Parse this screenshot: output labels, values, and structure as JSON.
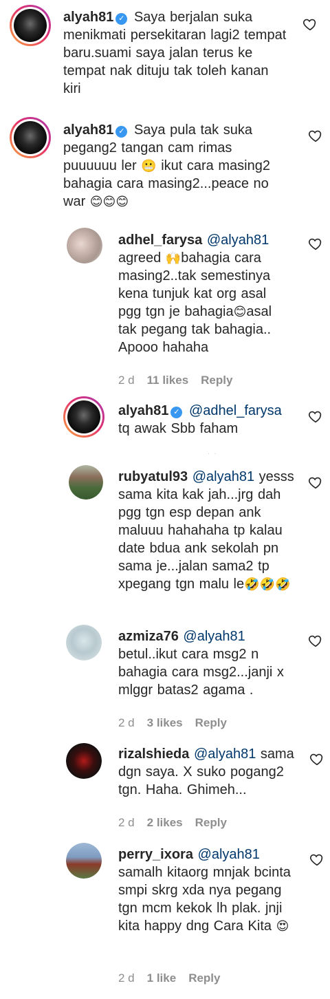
{
  "comments": [
    {
      "username": "alyah81",
      "mention": "",
      "text": "Saya berjalan suka menikmati persekitaran lagi2 tempat baru.suami saya jalan terus ke tempat nak dituju tak toleh kanan kiri",
      "verified": true
    },
    {
      "username": "alyah81",
      "mention": "",
      "text_a": "Saya pula tak suka pegang2 tangan cam rimas puuuuuu ler",
      "text_b": "ikut cara masing2 bahagia cara masing2...peace no war",
      "emoji_a": "😬",
      "emoji_b": "😊😊😊",
      "verified": true
    },
    {
      "username": "adhel_farysa",
      "mention": "@alyah81",
      "text_a": "agreed",
      "emoji_a": "🙌",
      "text_b": "bahagia cara masing2..tak semestinya kena tunjuk kat org asal pgg tgn je bahagia",
      "emoji_b": "😊",
      "text_c": "asal tak pegang tak bahagia.. Apooo hahaha",
      "time": "2 d",
      "likes": "11 likes",
      "reply": "Reply"
    },
    {
      "username": "alyah81",
      "mention": "@adhel_farysa",
      "text": "tq awak Sbb faham",
      "verified": true
    },
    {
      "username": "rubyatul93",
      "mention": "@alyah81",
      "text": "yesss sama kita kak jah...jrg dah pgg tgn esp depan ank maluuu hahahaha tp kalau date bdua ank sekolah pn sama je...jalan sama2 tp xpegang tgn malu le",
      "emoji": "🤣🤣🤣"
    },
    {
      "username": "azmiza76",
      "mention": "@alyah81",
      "text": "betul..ikut cara msg2 n bahagia cara msg2...janji x mlggr batas2 agama .",
      "time": "2 d",
      "likes": "3 likes",
      "reply": "Reply"
    },
    {
      "username": "rizalshieda",
      "mention": "@alyah81",
      "text": "sama dgn saya. X suko pogang2 tgn. Haha. Ghimeh...",
      "time": "2 d",
      "likes": "2 likes",
      "reply": "Reply"
    },
    {
      "username": "perry_ixora",
      "mention": "@alyah81",
      "text": "samalh kitaorg mnjak bcinta smpi skrg xda nya pegang tgn mcm kekok lh plak. jnji kita happy dng Cara Kita",
      "emoji": "😍",
      "time": "2 d",
      "likes": "1 like",
      "reply": "Reply"
    }
  ],
  "icons": {
    "heart": "heart-outline-icon",
    "verified": "verified-badge-icon"
  },
  "colors": {
    "verified": "#3897f0",
    "mention": "#00376b",
    "meta": "#8e8e8e"
  }
}
